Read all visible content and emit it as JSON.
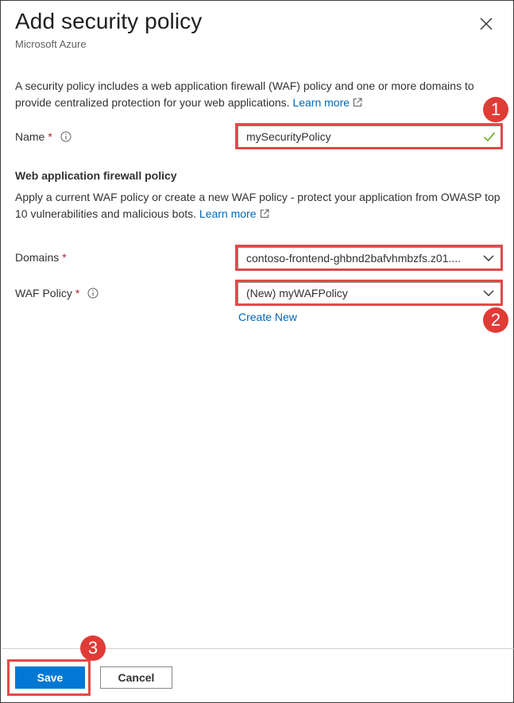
{
  "header": {
    "title": "Add security policy",
    "subtitle": "Microsoft Azure",
    "close_icon": "close-icon"
  },
  "intro": {
    "text": "A security policy includes a web application firewall (WAF) policy and one or more domains to provide centralized protection for your web applications. ",
    "learn_more": "Learn more"
  },
  "name_field": {
    "label": "Name",
    "required": "*",
    "value": "mySecurityPolicy",
    "valid_icon": "checkmark-icon"
  },
  "waf_section": {
    "title": "Web application firewall policy",
    "text": "Apply a current WAF policy or create a new WAF policy - protect your application from OWASP top 10 vulnerabilities and malicious bots. ",
    "learn_more": "Learn more"
  },
  "domains_field": {
    "label": "Domains",
    "required": "*",
    "value": "contoso-frontend-ghbnd2bafvhmbzfs.z01...."
  },
  "waf_policy_field": {
    "label": "WAF Policy",
    "required": "*",
    "value": "(New) myWAFPolicy",
    "create_new": "Create New"
  },
  "annotations": {
    "step1": "1",
    "step2": "2",
    "step3": "3",
    "color": "#e03b36"
  },
  "footer": {
    "save_label": "Save",
    "cancel_label": "Cancel"
  },
  "colors": {
    "accent": "#0078d4",
    "link": "#0067b8",
    "highlight": "#e04a4a",
    "required": "#a4262c",
    "valid": "#57a300"
  }
}
